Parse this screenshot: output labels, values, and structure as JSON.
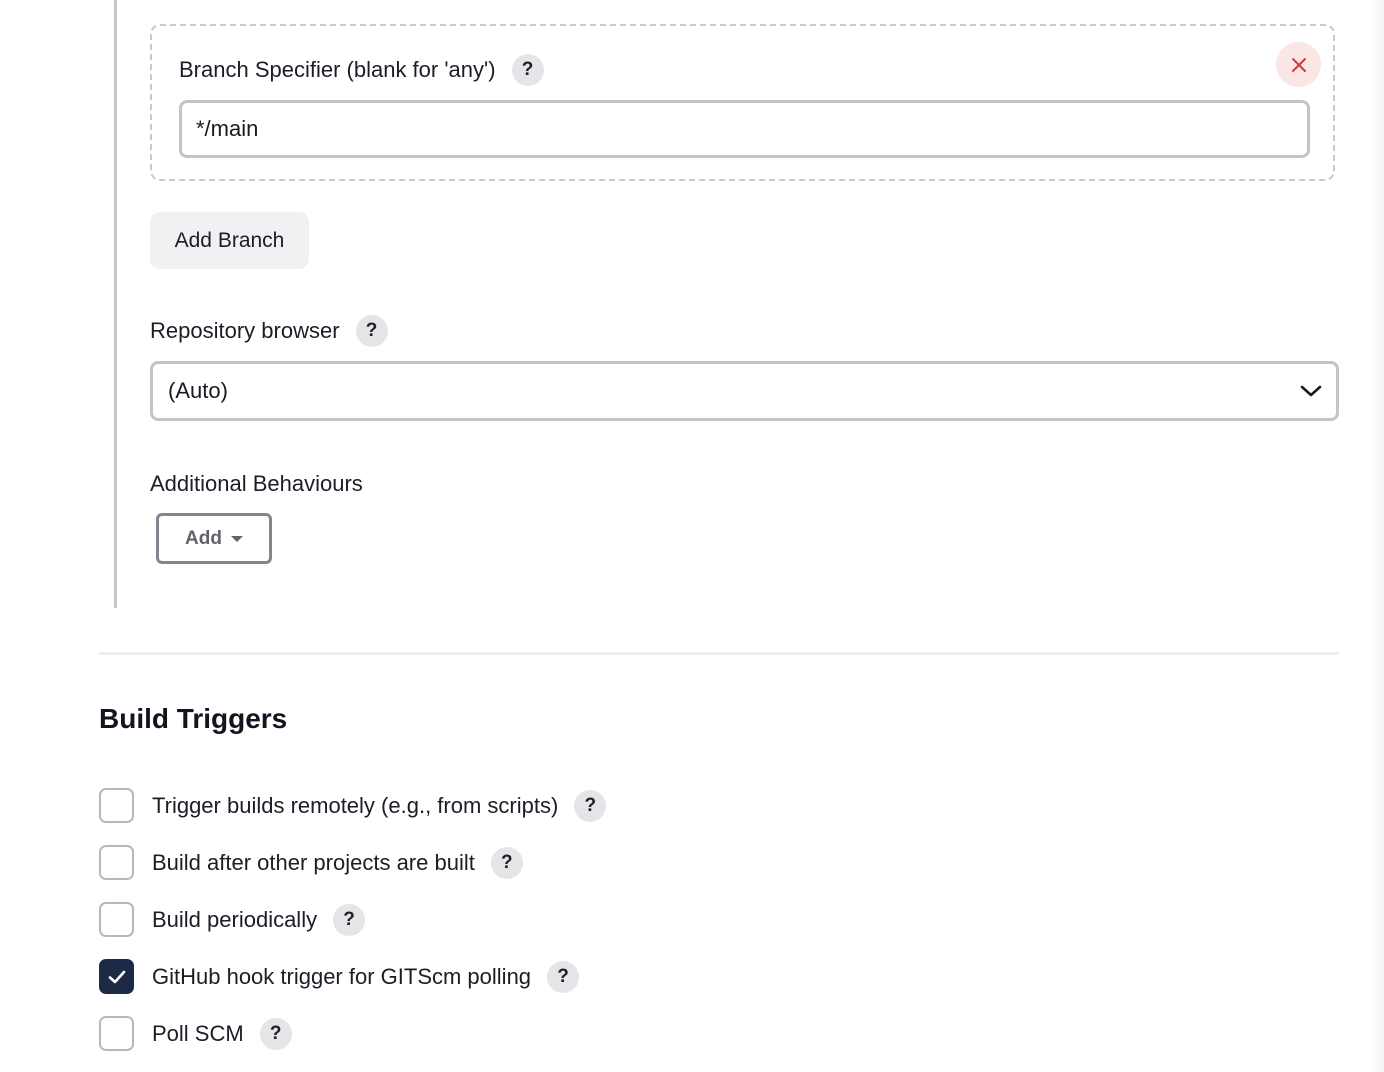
{
  "branch": {
    "label": "Branch Specifier (blank for 'any')",
    "value": "*/main",
    "add_branch_label": "Add Branch"
  },
  "repo_browser": {
    "label": "Repository browser",
    "selected": "(Auto)"
  },
  "additional_behaviours": {
    "label": "Additional Behaviours",
    "add_label": "Add"
  },
  "build_triggers": {
    "title": "Build Triggers",
    "items": [
      {
        "label": "Trigger builds remotely (e.g., from scripts)",
        "checked": false
      },
      {
        "label": "Build after other projects are built",
        "checked": false
      },
      {
        "label": "Build periodically",
        "checked": false
      },
      {
        "label": "GitHub hook trigger for GITScm polling",
        "checked": true
      },
      {
        "label": "Poll SCM",
        "checked": false
      }
    ]
  },
  "help_glyph": "?",
  "colors": {
    "checked_fill": "#1d2a45",
    "close_icon": "#d33a3a",
    "close_bg": "#fbe6e6"
  }
}
